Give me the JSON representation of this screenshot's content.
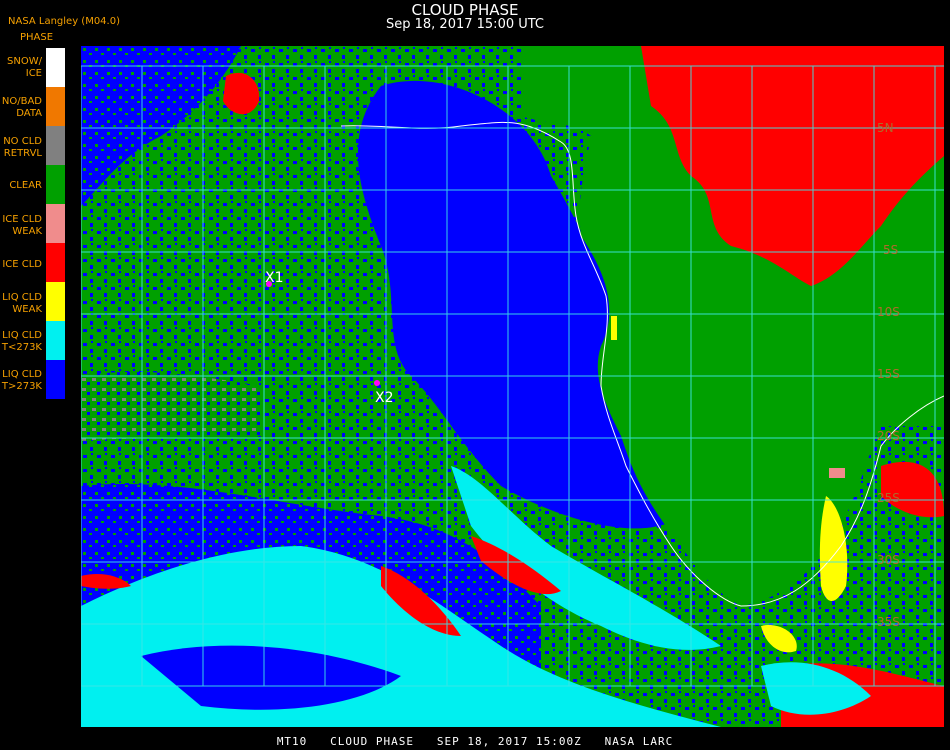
{
  "header": {
    "title": "CLOUD PHASE",
    "date": "Sep 18, 2017 15:00 UTC"
  },
  "agency": "NASA Langley (M04.0)",
  "legend": {
    "title": "PHASE",
    "items": [
      {
        "label": "SNOW/\nICE",
        "color": "#ffffff"
      },
      {
        "label": "NO/BAD\nDATA",
        "color": "#f07800"
      },
      {
        "label": "NO CLD\nRETRVL",
        "color": "#808080"
      },
      {
        "label": "CLEAR",
        "color": "#00a000"
      },
      {
        "label": "ICE CLD\nWEAK",
        "color": "#f08c8c"
      },
      {
        "label": "ICE CLD",
        "color": "#ff0000"
      },
      {
        "label": "LIQ CLD\nWEAK",
        "color": "#ffff00"
      },
      {
        "label": "LIQ CLD\nT<273K",
        "color": "#00f0f0"
      },
      {
        "label": "LIQ CLD\nT>273K",
        "color": "#0000ff"
      }
    ]
  },
  "markers": [
    {
      "label": "X1"
    },
    {
      "label": "X2"
    }
  ],
  "lat_labels": [
    "5N",
    "5S",
    "10S",
    "15S",
    "20S",
    "25S",
    "30S",
    "35S"
  ],
  "footer": "MT10   CLOUD PHASE   SEP 18, 2017 15:00Z   NASA LARC",
  "colors": {
    "grid": "#3ee6e6",
    "coast": "#ffffff",
    "text_accent": "#f5a000"
  }
}
